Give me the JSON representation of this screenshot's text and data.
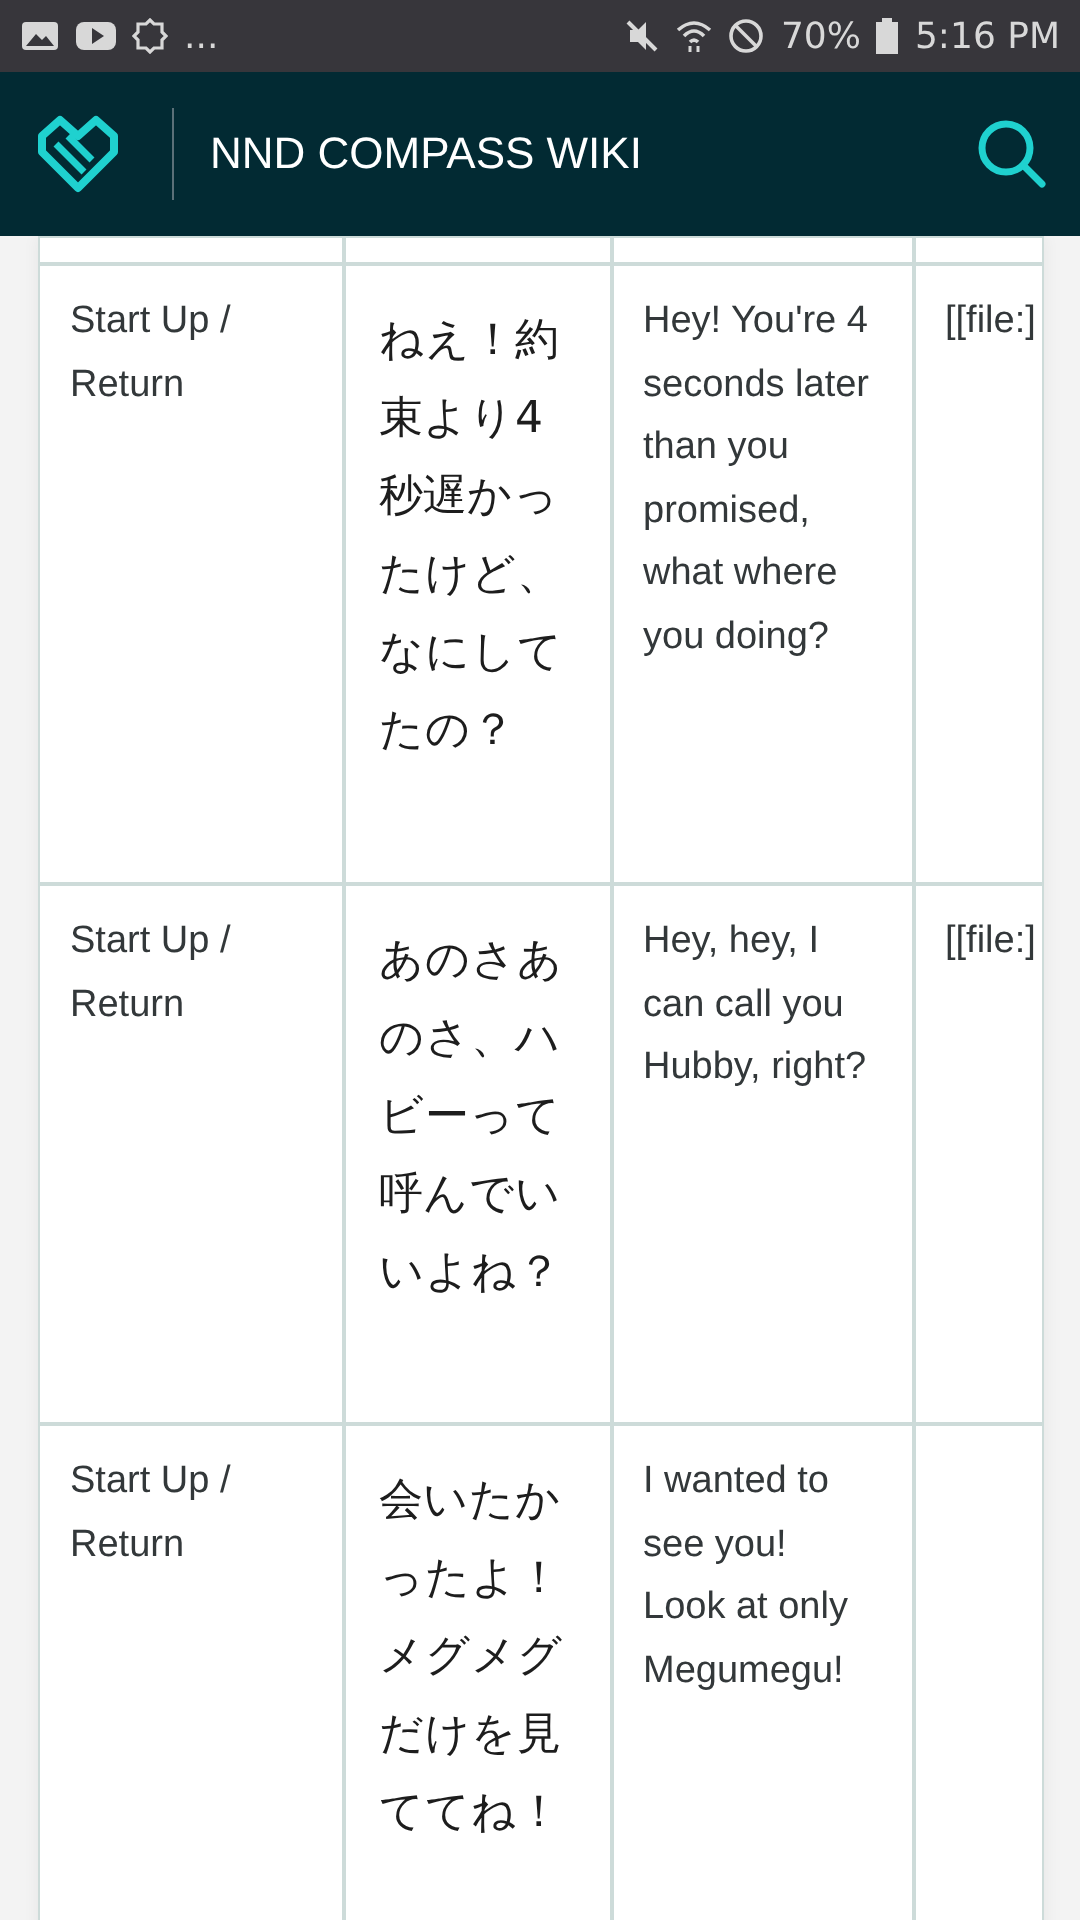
{
  "status_bar": {
    "overflow": "...",
    "battery": "70%",
    "time": "5:16 PM"
  },
  "header": {
    "title": "NND COMPASS WIKI"
  },
  "table": {
    "rows": [
      {
        "trigger": "Start Up / Return",
        "japanese": "ねえ！約束より4秒遅かったけど、なにしてたの？",
        "english": "Hey! You're 4 seconds later than you promised, what where you doing?",
        "file": "[[file:]"
      },
      {
        "trigger": "Start Up / Return",
        "japanese": "あのさあのさ、ハビーって呼んでいいよね？",
        "english": "Hey, hey, I can call you Hubby, right?",
        "file": "[[file:]"
      },
      {
        "trigger": "Start Up / Return",
        "japanese": "会いたかったよ！メグメグだけを見ててね！",
        "english": "I wanted to see you! Look at only Megumegu!"
      }
    ]
  }
}
